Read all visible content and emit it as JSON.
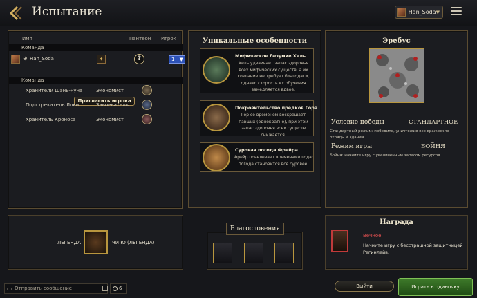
{
  "header": {
    "title": "Испытание",
    "user_name": "Han_Soda"
  },
  "players": {
    "col_name": "Имя",
    "col_pantheon": "Пантеон",
    "col_player": "Игрок",
    "team1_label": "Команда",
    "team2_label": "Команда",
    "human": {
      "name": "Han_Soda",
      "help": "?",
      "team": "1"
    },
    "invite_label": "Пригласить игрока",
    "ai": [
      {
        "name": "Хранители Шэнь-нуна",
        "personality": "Экономист"
      },
      {
        "name": "Подстрекатель Локи",
        "personality": "Завоеватель"
      },
      {
        "name": "Хранитель Кроноса",
        "personality": "Экономист"
      }
    ]
  },
  "features": {
    "title": "Уникальные особенности",
    "items": [
      {
        "title": "Мифическое безумие Хель",
        "desc": "Хель удваивает запас здоровья всех мифических существ, а их создание не требует благодати, однако скорость их обучения замедляется вдвое."
      },
      {
        "title": "Покровительство предков Гора",
        "desc": "Гор со временем воскрешает павших (однократно), при этом запас здоровья всех существ снижается."
      },
      {
        "title": "Суровая погода Фрейра",
        "desc": "Фрейр повелевает временами года: погода становится всё суровее."
      }
    ]
  },
  "map": {
    "title": "Эребус",
    "victory_label": "Условие победы",
    "victory_value": "СТАНДАРТНОЕ",
    "victory_desc": "Стандартный режим: победите, уничтожив все вражеские отряды и здания.",
    "mode_label": "Режим игры",
    "mode_value": "БОЙНЯ",
    "mode_desc": "Бойня: начните игру с увеличенным запасом ресурсов."
  },
  "civ": {
    "left_label": "ЛЕГЕНДА",
    "right_label": "ЧИ Ю (ЛЕГЕНДА)"
  },
  "blessings": {
    "title": "Благословения"
  },
  "reward": {
    "title": "Награда",
    "type": "Вечное",
    "desc": "Начните игру с бесстрашной защитницей Регинлейв."
  },
  "footer": {
    "chat_placeholder": "Отправить сообщение",
    "online_count": "6",
    "exit_label": "Выйти",
    "play_label": "Играть в одиночку"
  },
  "colors": {
    "gold_border": "#b8963e",
    "play_green": "#3e7a2a",
    "team_blue": "#2d52b8",
    "reward_red": "#e05050"
  }
}
